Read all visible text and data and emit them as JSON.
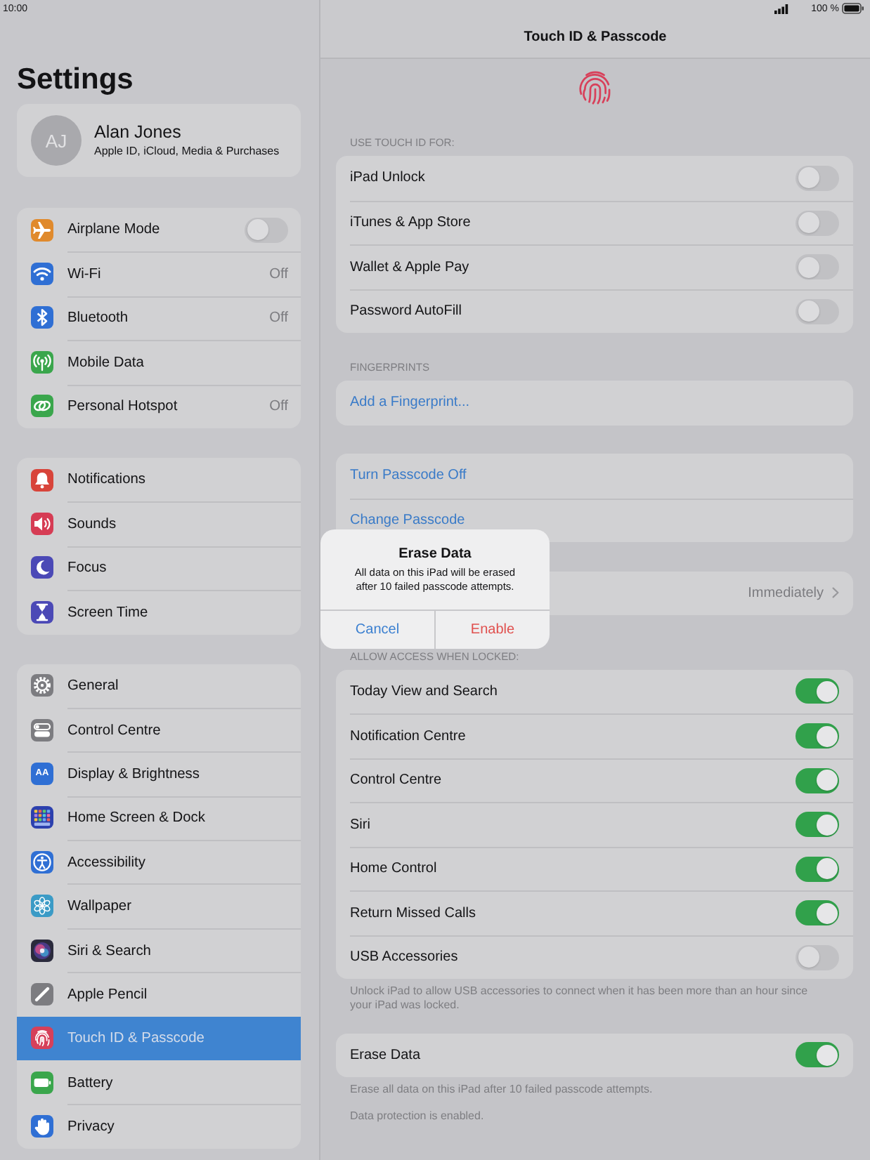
{
  "status_bar": {
    "time": "10:00",
    "battery": "100 %"
  },
  "sidebar": {
    "title": "Settings",
    "profile": {
      "initials": "AJ",
      "name": "Alan Jones",
      "subtitle": "Apple ID, iCloud, Media & Purchases"
    },
    "groups": [
      {
        "items": [
          {
            "kind": "toggle",
            "label": "Airplane Mode",
            "color": "#e08a2c",
            "on": false,
            "selected": false
          },
          {
            "kind": "value",
            "label": "Wi-Fi",
            "color": "#2f6fd4",
            "value": "Off",
            "selected": false
          },
          {
            "kind": "value",
            "label": "Bluetooth",
            "color": "#2f6fd4",
            "value": "Off",
            "selected": false
          },
          {
            "kind": "plain",
            "label": "Mobile Data",
            "color": "#3aa64c",
            "selected": false
          },
          {
            "kind": "value",
            "label": "Personal Hotspot",
            "color": "#3aa64c",
            "value": "Off",
            "selected": false
          }
        ]
      },
      {
        "items": [
          {
            "kind": "plain",
            "label": "Notifications",
            "color": "#d8443a",
            "selected": false
          },
          {
            "kind": "plain",
            "label": "Sounds",
            "color": "#d63c54",
            "selected": false
          },
          {
            "kind": "plain",
            "label": "Focus",
            "color": "#4b49b6",
            "selected": false
          },
          {
            "kind": "plain",
            "label": "Screen Time",
            "color": "#4b49b6",
            "selected": false
          }
        ]
      },
      {
        "items": [
          {
            "kind": "plain",
            "label": "General",
            "color": "#7c7c80",
            "selected": false
          },
          {
            "kind": "plain",
            "label": "Control Centre",
            "color": "#7c7c80",
            "selected": false
          },
          {
            "kind": "plain",
            "label": "Display & Brightness",
            "color": "#2f6fd4",
            "icon_text": "AA",
            "selected": false
          },
          {
            "kind": "plain",
            "label": "Home Screen & Dock",
            "color": "#2c40ae",
            "selected": false
          },
          {
            "kind": "plain",
            "label": "Accessibility",
            "color": "#2f6fd4",
            "selected": false
          },
          {
            "kind": "plain",
            "label": "Wallpaper",
            "color": "#3b9bc6",
            "selected": false
          },
          {
            "kind": "plain",
            "label": "Siri & Search",
            "color": "#2a2a3c",
            "selected": false
          },
          {
            "kind": "plain",
            "label": "Apple Pencil",
            "color": "#7c7c80",
            "selected": false
          },
          {
            "kind": "plain",
            "label": "Touch ID & Passcode",
            "color": "#d6405a",
            "selected": true
          },
          {
            "kind": "plain",
            "label": "Battery",
            "color": "#3aa64c",
            "selected": false
          },
          {
            "kind": "plain",
            "label": "Privacy",
            "color": "#2f6fd4",
            "selected": false
          }
        ]
      }
    ]
  },
  "detail": {
    "title": "Touch ID & Passcode",
    "sections": [
      {
        "header": "USE TOUCH ID FOR:",
        "rows": [
          {
            "kind": "toggle",
            "label": "iPad Unlock",
            "on": false
          },
          {
            "kind": "toggle",
            "label": "iTunes & App Store",
            "on": false
          },
          {
            "kind": "toggle",
            "label": "Wallet & Apple Pay",
            "on": false
          },
          {
            "kind": "toggle",
            "label": "Password AutoFill",
            "on": false
          }
        ]
      },
      {
        "header": "FINGERPRINTS",
        "rows": [
          {
            "kind": "action",
            "label": "Add a Fingerprint..."
          }
        ]
      },
      {
        "rows": [
          {
            "kind": "action",
            "label": "Turn Passcode Off"
          },
          {
            "kind": "action",
            "label": "Change Passcode"
          }
        ]
      },
      {
        "rows": [
          {
            "kind": "disclosure",
            "value": "Immediately"
          }
        ]
      },
      {
        "header": "ALLOW ACCESS WHEN LOCKED:",
        "rows": [
          {
            "kind": "toggle",
            "label": "Today View and Search",
            "on": true
          },
          {
            "kind": "toggle",
            "label": "Notification Centre",
            "on": true
          },
          {
            "kind": "toggle",
            "label": "Control Centre",
            "on": true
          },
          {
            "kind": "toggle",
            "label": "Siri",
            "on": true
          },
          {
            "kind": "toggle",
            "label": "Home Control",
            "on": true
          },
          {
            "kind": "toggle",
            "label": "Return Missed Calls",
            "on": true
          },
          {
            "kind": "toggle",
            "label": "USB Accessories",
            "on": false
          }
        ],
        "footer": [
          "Unlock iPad to allow USB accessories to connect when it has been more than an hour since your iPad was locked."
        ]
      },
      {
        "rows": [
          {
            "kind": "toggle",
            "label": "Erase Data",
            "on": true
          }
        ],
        "footer": [
          "Erase all data on this iPad after 10 failed passcode attempts.",
          "Data protection is enabled."
        ]
      }
    ]
  },
  "alert": {
    "title": "Erase Data",
    "message": "All data on this iPad will be erased after 10 failed passcode attempts.",
    "buttons": [
      {
        "kind": "cancel",
        "label": "Cancel"
      },
      {
        "kind": "destructive",
        "label": "Enable"
      }
    ]
  }
}
